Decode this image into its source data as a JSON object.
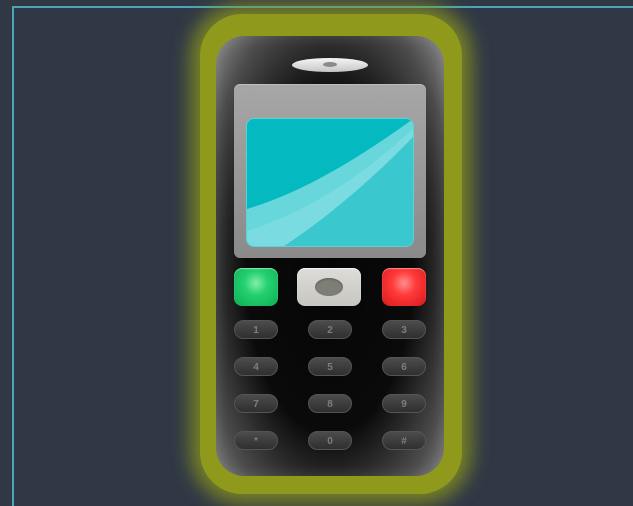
{
  "phone": {
    "keypad": [
      {
        "label": "1"
      },
      {
        "label": "2"
      },
      {
        "label": "3"
      },
      {
        "label": "4"
      },
      {
        "label": "5"
      },
      {
        "label": "6"
      },
      {
        "label": "7"
      },
      {
        "label": "8"
      },
      {
        "label": "9"
      },
      {
        "label": "*"
      },
      {
        "label": "0"
      },
      {
        "label": "#"
      }
    ],
    "icons": {
      "speaker": "speaker-icon",
      "call": "call-button",
      "end": "end-button",
      "navigation": "navigation-key"
    },
    "colors": {
      "background": "#303846",
      "frame_line": "#4aa6b4",
      "glow": "#8f9a1c",
      "body": "#111111",
      "screen": "#05b9c0",
      "call": "#22cf72",
      "end": "#ff3a3a"
    }
  }
}
